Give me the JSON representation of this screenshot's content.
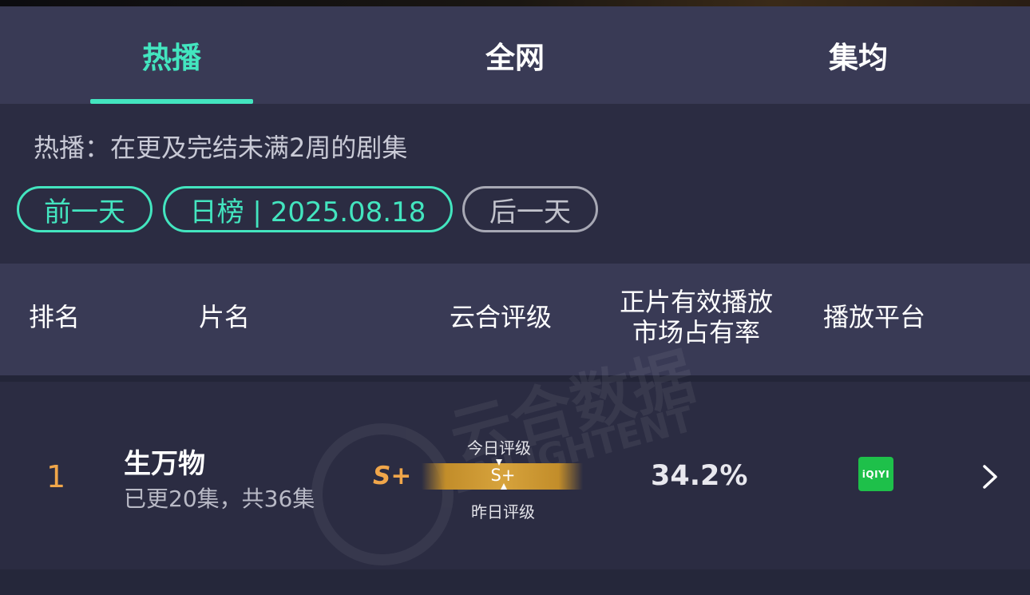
{
  "tabs": [
    {
      "label": "热播",
      "active": true
    },
    {
      "label": "全网",
      "active": false
    },
    {
      "label": "集均",
      "active": false
    }
  ],
  "description": "热播：在更及完结未满2周的剧集",
  "filters": {
    "prev_day": "前一天",
    "date_pill": "日榜 | 2025.08.18",
    "next_day": "后一天"
  },
  "columns": {
    "rank": "排名",
    "name": "片名",
    "rating": "云合评级",
    "share_line1": "正片有效播放",
    "share_line2": "市场占有率",
    "platform": "播放平台"
  },
  "rows": [
    {
      "rank": "1",
      "title": "生万物",
      "episodes": "已更20集，共36集",
      "grade": "S+",
      "today_label": "今日评级",
      "bar_grade": "S+",
      "yesterday_label": "昨日评级",
      "share": "34.2%",
      "platform_logo": "iQIYI",
      "platform_icon": "iqiyi-icon"
    }
  ],
  "colors": {
    "accent": "#43e5bf",
    "grade": "#f0a64a",
    "platform": "#1ec04a"
  }
}
